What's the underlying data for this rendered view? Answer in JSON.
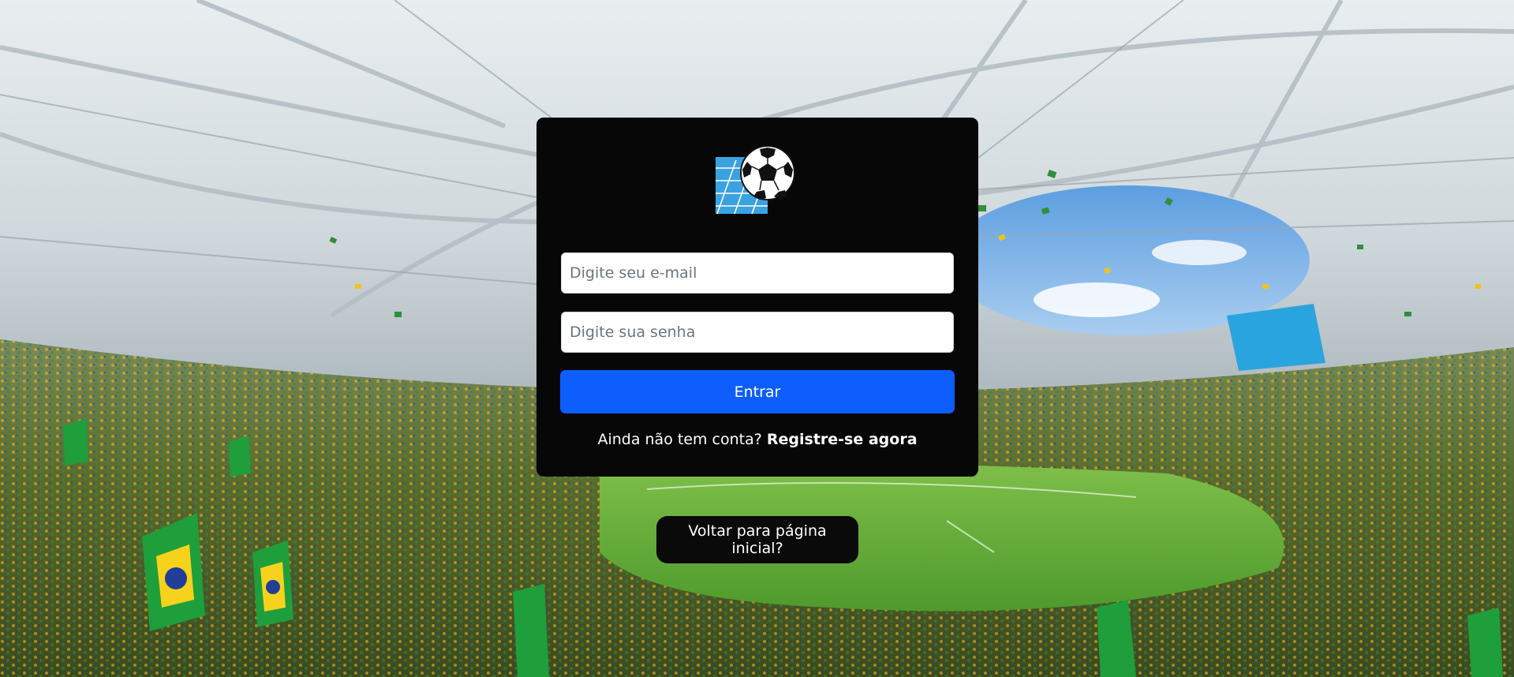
{
  "page": {
    "background_description_icon": "stadium-background",
    "colors": {
      "card_bg": "#070707",
      "primary": "#0d5efd",
      "back_button_bg": "#0a0a0a"
    }
  },
  "logo": {
    "icon": "soccer-ball-logo-icon"
  },
  "login_form": {
    "email_placeholder": "Digite seu e-mail",
    "password_placeholder": "Digite sua senha",
    "submit_label": "Entrar",
    "register_prompt": "Ainda não tem conta?",
    "register_link": "Registre-se agora"
  },
  "back_button": {
    "label": "Voltar para página inicial?"
  }
}
